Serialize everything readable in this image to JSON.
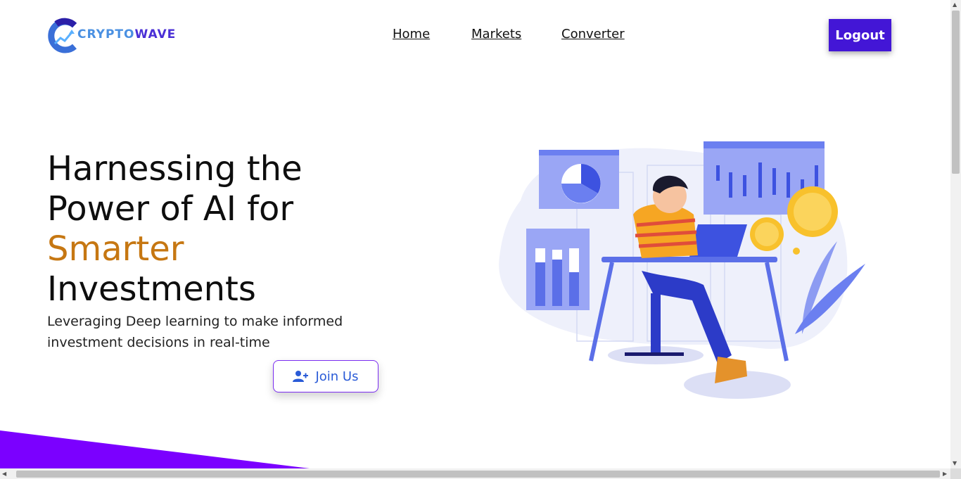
{
  "brand": {
    "name_part1": "CRYPTO",
    "name_part2": "WAVE"
  },
  "nav": {
    "home": "Home",
    "markets": "Markets",
    "converter": "Converter"
  },
  "header": {
    "logout_label": "Logout"
  },
  "hero": {
    "title_line1": "Harnessing the",
    "title_line2": "Power of AI for",
    "title_accent": "Smarter",
    "title_line4": "Investments",
    "subtitle": "Leveraging Deep learning to make informed investment decisions in real-time",
    "join_label": "Join Us"
  },
  "colors": {
    "accent": "#c67712",
    "primary": "#4316d6",
    "illustration": "#6b7ff0",
    "wedge": "#7b00ff"
  },
  "icons": {
    "join": "user-plus-icon",
    "logo": "crypto-logo-icon"
  }
}
